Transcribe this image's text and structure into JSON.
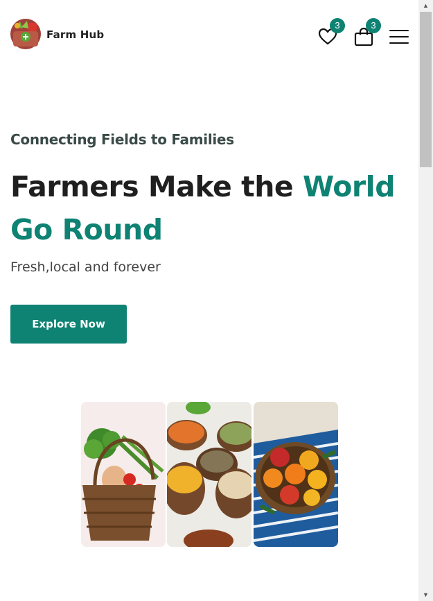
{
  "header": {
    "brand": "Farm Hub",
    "wishlist_icon": "heart-icon",
    "wishlist_count": "3",
    "cart_icon": "shopping-bag-icon",
    "cart_count": "3",
    "menu_icon": "hamburger-menu-icon"
  },
  "hero": {
    "tagline": "Connecting Fields to Families",
    "headline_main": "Farmers Make the ",
    "headline_accent": "World Go Round",
    "subtitle": "Fresh,local and forever",
    "cta_label": "Explore Now"
  },
  "gallery": {
    "images": [
      "vegetable-basket",
      "grains-and-pulses-bowls",
      "fruit-basket"
    ]
  },
  "colors": {
    "accent": "#0e8273",
    "text": "#1f1f1f"
  }
}
